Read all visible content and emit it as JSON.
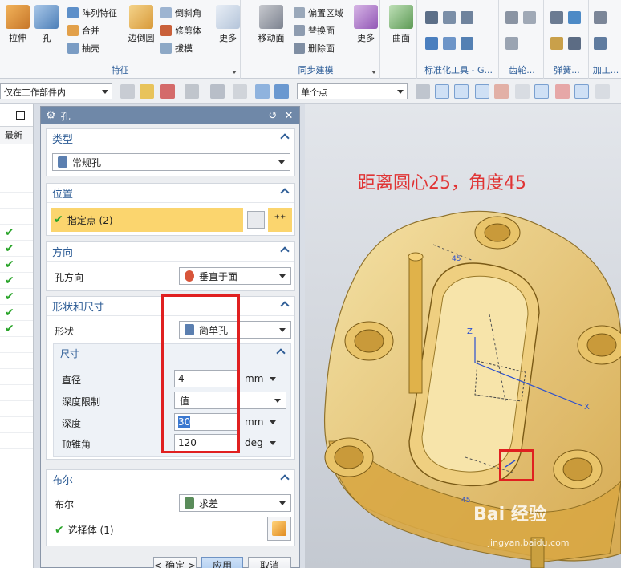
{
  "ribbon": {
    "groups": [
      {
        "label": "特征",
        "items": [
          "拉伸",
          "孔",
          "阵列特征",
          "合并",
          "抽壳",
          "边倒圆",
          "倒斜角",
          "修剪体",
          "拔模",
          "更多"
        ]
      },
      {
        "label": "同步建模",
        "items": [
          "移动面",
          "偏置区域",
          "替换面",
          "删除面",
          "更多"
        ]
      },
      {
        "label": "",
        "items": [
          "曲面"
        ]
      },
      {
        "label": "标准化工具 - G...",
        "items": []
      },
      {
        "label": "齿轮...",
        "items": []
      },
      {
        "label": "弹簧...",
        "items": []
      },
      {
        "label": "加工...",
        "items": []
      }
    ]
  },
  "seltb": {
    "filter": "仅在工作部件内",
    "snap": "单个点"
  },
  "nav": {
    "column": "最新"
  },
  "dialog": {
    "title": "孔",
    "type": {
      "header": "类型",
      "value": "常规孔"
    },
    "position": {
      "header": "位置",
      "value": "指定点 (2)"
    },
    "direction": {
      "header": "方向",
      "label": "孔方向",
      "value": "垂直于面"
    },
    "shape": {
      "header": "形状和尺寸",
      "label": "形状",
      "value": "简单孔",
      "dims_header": "尺寸",
      "diameter_label": "直径",
      "diameter": "4",
      "diameter_unit": "mm",
      "depth_limit_label": "深度限制",
      "depth_limit": "值",
      "depth_label": "深度",
      "depth": "30",
      "depth_unit": "mm",
      "tip_label": "顶锥角",
      "tip": "120",
      "tip_unit": "deg"
    },
    "boolean": {
      "header": "布尔",
      "label": "布尔",
      "value": "求差",
      "select_body": "选择体 (1)"
    },
    "ok": "< 确定 >",
    "apply": "应用",
    "cancel": "取消"
  },
  "viewport": {
    "annotation": "距离圆心25，角度45",
    "axis_z": "Z",
    "axis_x": "X",
    "dim1": "45",
    "dim2": "45",
    "watermark": "Bai 经验",
    "watermark_url": "jingyan.baidu.com"
  }
}
